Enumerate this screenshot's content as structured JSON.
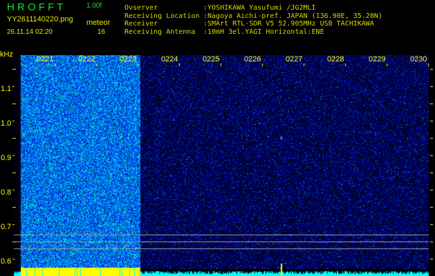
{
  "app": {
    "name": "H R O F F T",
    "version": "1.00f"
  },
  "file": {
    "name": "YY2611140220.png",
    "datetime": "26.11.14 02:20"
  },
  "mode": {
    "label": "meteor",
    "count": "16"
  },
  "info": [
    {
      "label": "Ovserver",
      "value": ":YOSHIKAWA Yasufumi /JG2MLI"
    },
    {
      "label": "Receiving Location",
      "value": ":Nagoya Aichi-pref. JAPAN (136.90E, 35.20N)"
    },
    {
      "label": "Receiver",
      "value": ":SMArt RTL-SDR V5 52.905MHz USB TACHIKAWA"
    },
    {
      "label": "Receiving Antenna",
      "value": ":10mH 3el.YAGI Horizontal:ENE"
    }
  ],
  "chart_data": {
    "type": "heatmap",
    "ylabel": "kHz",
    "x_ticks": [
      "0221",
      "0222",
      "0223",
      "0224",
      "0225",
      "0226",
      "0227",
      "0228",
      "0229",
      "0230"
    ],
    "y_ticks": [
      "1.1",
      "1.0",
      "0.9",
      "0.8",
      "0.7",
      "0.6"
    ],
    "ylim": [
      0.56,
      1.2
    ],
    "colormap": [
      "#000010",
      "#0010c0",
      "#0080ff",
      "#00ffff",
      "#00ff40",
      "#ffff00",
      "#ff0000"
    ],
    "high_noise_interval": [
      "0220",
      "0223"
    ],
    "reference_lines_khz": [
      0.62,
      0.6,
      0.58
    ],
    "meteor_echo": {
      "time": "0227",
      "khz": 0.9
    }
  }
}
